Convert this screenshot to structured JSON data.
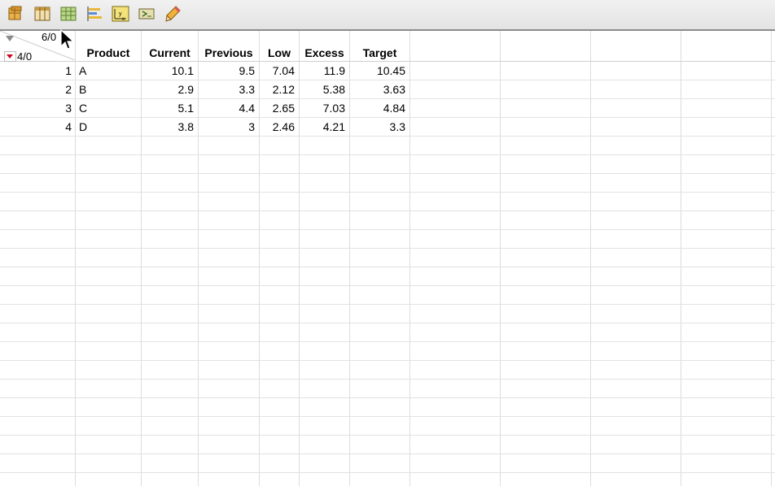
{
  "toolbar": {
    "icons": [
      "table-icon",
      "columns-icon",
      "grid-icon",
      "bar-chart-icon",
      "graph-icon",
      "script-icon",
      "pencil-icon"
    ]
  },
  "table": {
    "corner": {
      "columns_count": "6/0",
      "rows_count": "4/0"
    },
    "headers": [
      "Product",
      "Current",
      "Previous",
      "Low",
      "Excess",
      "Target"
    ],
    "rows": [
      {
        "num": "1",
        "cells": [
          "A",
          "10.1",
          "9.5",
          "7.04",
          "11.9",
          "10.45"
        ]
      },
      {
        "num": "2",
        "cells": [
          "B",
          "2.9",
          "3.3",
          "2.12",
          "5.38",
          "3.63"
        ]
      },
      {
        "num": "3",
        "cells": [
          "C",
          "5.1",
          "4.4",
          "2.65",
          "7.03",
          "4.84"
        ]
      },
      {
        "num": "4",
        "cells": [
          "D",
          "3.8",
          "3",
          "2.46",
          "4.21",
          "3.3"
        ]
      }
    ]
  }
}
